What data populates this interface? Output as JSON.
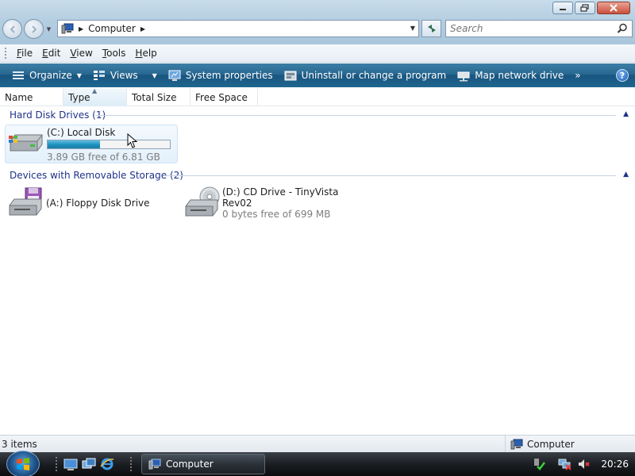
{
  "window": {
    "caption_buttons": [
      "minimize",
      "maximize",
      "close"
    ]
  },
  "navigation": {
    "address_crumb": "Computer",
    "search_placeholder": "Search"
  },
  "menu": {
    "items": [
      {
        "label": "File",
        "u": "F",
        "rest": "ile"
      },
      {
        "label": "Edit",
        "u": "E",
        "rest": "dit"
      },
      {
        "label": "View",
        "u": "V",
        "rest": "iew"
      },
      {
        "label": "Tools",
        "u": "T",
        "rest": "ools"
      },
      {
        "label": "Help",
        "u": "H",
        "rest": "elp"
      }
    ]
  },
  "toolbar": {
    "organize": "Organize",
    "views": "Views",
    "system_properties": "System properties",
    "uninstall": "Uninstall or change a program",
    "map_drive": "Map network drive",
    "more": "»",
    "help": "?"
  },
  "columns": [
    "Name",
    "Type",
    "Total Size",
    "Free Space"
  ],
  "groups": {
    "hard_disks": {
      "header": "Hard Disk Drives (1)",
      "drives": [
        {
          "name": "(C:) Local Disk",
          "free_text": "3.89 GB free of 6.81 GB",
          "used_fraction": 0.43
        }
      ]
    },
    "removable": {
      "header": "Devices with Removable Storage (2)",
      "drives": [
        {
          "name": "(A:) Floppy Disk Drive"
        },
        {
          "name_line1": "(D:) CD Drive - TinyVista",
          "name_line2": "Rev02",
          "free_text": "0 bytes free of 699 MB"
        }
      ]
    }
  },
  "status": {
    "count": "3 items",
    "location": "Computer"
  },
  "taskbar": {
    "active_window": "Computer",
    "clock": "20:26"
  }
}
